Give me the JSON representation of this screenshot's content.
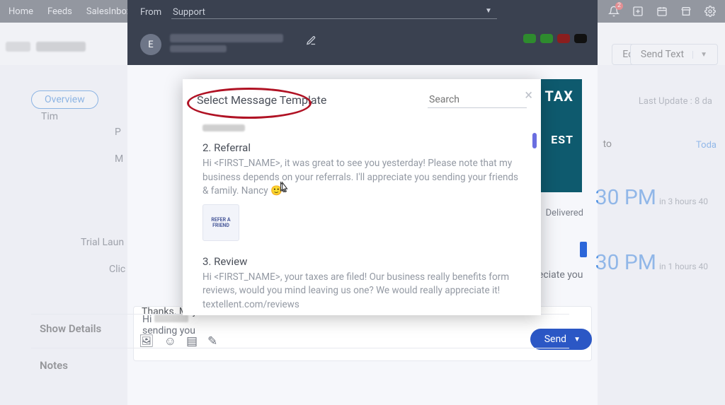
{
  "nav": {
    "home": "Home",
    "feeds": "Feeds",
    "salesinbox": "SalesInbox",
    "bell_badge": "2"
  },
  "header": {
    "from_label": "From",
    "from_value": "Support",
    "avatar_letter": "E"
  },
  "actions": {
    "edit": "Edit",
    "send_text": "Send Text"
  },
  "tabs": {
    "overview": "Overview",
    "timeline": "Tim"
  },
  "side_items": {
    "p": "P",
    "m": "M",
    "trial": "Trial Laun",
    "click": "Clic"
  },
  "compose": {
    "line1": "Hi",
    "line2": "sending you",
    "appreciate": "eciate you",
    "thanks": "Thanks. Majeed",
    "send": "Send"
  },
  "details": {
    "show": "Show Details",
    "notes": "Notes"
  },
  "right": {
    "last_update": "Last Update : 8 da",
    "to": "to",
    "today": "Toda",
    "time1": "30 PM",
    "time1_rel": "in 3 hours 40",
    "delivered": "Delivered",
    "time2": "30 PM",
    "time2_rel": "in 1 hours 40"
  },
  "banner": {
    "l1": "R TAX",
    "l2": "EST"
  },
  "modal": {
    "title": "Select Message Template",
    "search_placeholder": "Search",
    "templates": [
      {
        "title": "2. Referral",
        "body": "Hi <FIRST_NAME>, it was great to see you yesterday! Please note that my business depends on your referrals. I'll appreciate you sending your friends & family. Nancy 🙂",
        "thumb_label": "REFER A FRIEND"
      },
      {
        "title": "3. Review",
        "body": "Hi <FIRST_NAME>, your taxes are filed! Our business really benefits form reviews, would you mind leaving us one? We would really appreciate it! textellent.com/reviews"
      }
    ]
  }
}
